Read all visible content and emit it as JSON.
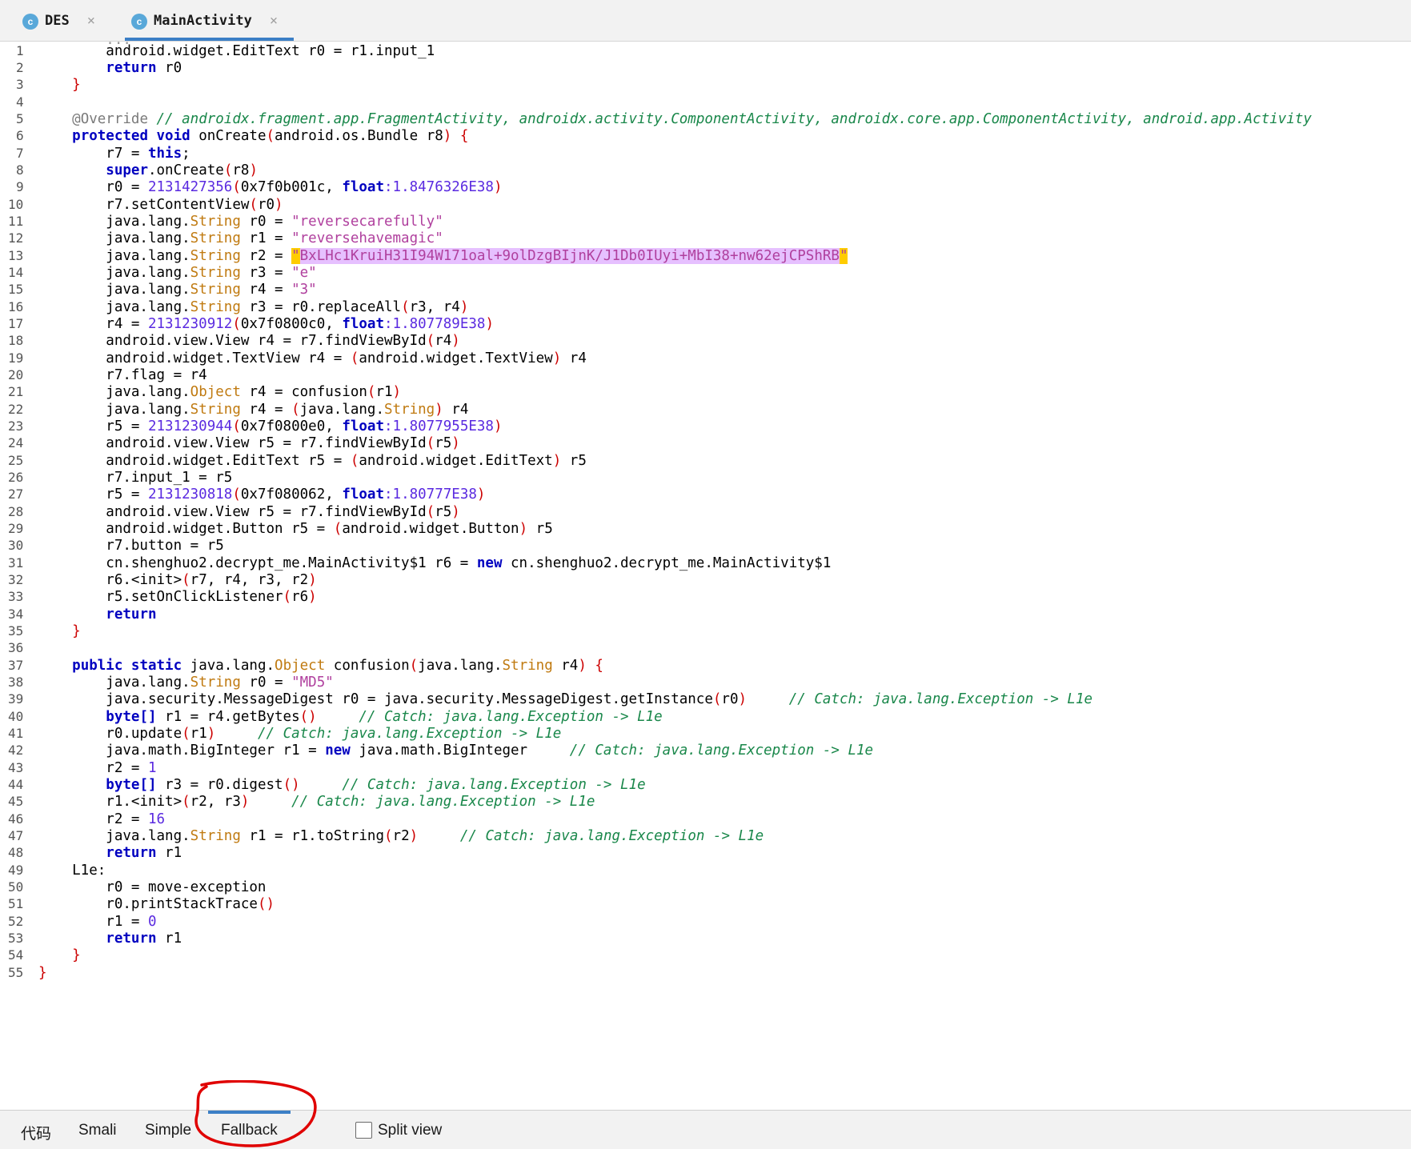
{
  "tabs": [
    {
      "icon": "class-icon",
      "icon_letter": "c",
      "label": "DES"
    },
    {
      "icon": "class-icon",
      "icon_letter": "c",
      "label": "MainActivity"
    }
  ],
  "close_glyph": "×",
  "line_numbers": [
    "1",
    "2",
    "3",
    "4",
    "5",
    "6",
    "7",
    "8",
    "9",
    "10",
    "11",
    "12",
    "13",
    "14",
    "15",
    "16",
    "17",
    "18",
    "19",
    "20",
    "21",
    "22",
    "23",
    "24",
    "25",
    "26",
    "27",
    "28",
    "29",
    "30",
    "31",
    "32",
    "33",
    "34",
    "35",
    "36",
    "37",
    "38",
    "39",
    "40",
    "41",
    "42",
    "43",
    "44",
    "45",
    "46",
    "47",
    "48",
    "49",
    "50",
    "51",
    "52",
    "53",
    "54",
    "55"
  ],
  "code": {
    "l1_a": "        android.widget.EditText r0 = r1.input_1",
    "l2_kw": "return",
    "l2_b": " r0",
    "l3_brace": "}",
    "l5_ann": "@Override",
    "l5_cm": " // androidx.fragment.app.FragmentActivity, androidx.activity.ComponentActivity, androidx.core.app.ComponentActivity, android.app.Activity",
    "l6_kw": "protected void",
    "l6_b": " onCreate",
    "l6_p": "(",
    "l6_c": "android.os.Bundle r8",
    "l6_e": ") {",
    "l7_a": "        r7 = ",
    "l7_kw": "this",
    "l7_b": ";",
    "l8_kw": "super",
    "l8_a": ".onCreate",
    "l8_p1": "(",
    "l8_b": "r8",
    "l8_p2": ")",
    "l9_a": "        r0 = ",
    "l9_n": "2131427356",
    "l9_p1": "(",
    "l9_h": "0x7f0b001c",
    "l9_c": ", ",
    "l9_kw": "float",
    "l9_n2": ":1.8476326E38",
    "l9_p2": ")",
    "l10_a": "        r7.setContentView",
    "l10_p1": "(",
    "l10_b": "r0",
    "l10_p2": ")",
    "l11_a": "        java.lang.",
    "l11_t": "String",
    "l11_b": " r0 = ",
    "l11_s": "\"reversecarefully\"",
    "l12_a": "        java.lang.",
    "l12_t": "String",
    "l12_b": " r1 = ",
    "l12_s": "\"reversehavemagic\"",
    "l13_a": "        java.lang.",
    "l13_t": "String",
    "l13_b": " r2 = ",
    "l13_q1": "\"",
    "l13_s": "BxLHc1KruiH31I94W171oal+9olDzgBIjnK/J1Db0IUyi+MbI38+nw62ejCPShRB",
    "l13_q2": "\"",
    "l14_a": "        java.lang.",
    "l14_t": "String",
    "l14_b": " r3 = ",
    "l14_s": "\"e\"",
    "l15_a": "        java.lang.",
    "l15_t": "String",
    "l15_b": " r4 = ",
    "l15_s": "\"3\"",
    "l16_a": "        java.lang.",
    "l16_t": "String",
    "l16_b": " r3 = r0.replaceAll",
    "l16_p1": "(",
    "l16_c": "r3, r4",
    "l16_p2": ")",
    "l17_a": "        r4 = ",
    "l17_n": "2131230912",
    "l17_p1": "(",
    "l17_h": "0x7f0800c0",
    "l17_c": ", ",
    "l17_kw": "float",
    "l17_n2": ":1.807789E38",
    "l17_p2": ")",
    "l18_a": "        android.view.View r4 = r7.findViewById",
    "l18_p1": "(",
    "l18_b": "r4",
    "l18_p2": ")",
    "l19_a": "        android.widget.TextView r4 = ",
    "l19_p1": "(",
    "l19_b": "android.widget.TextView",
    "l19_p2": ")",
    "l19_c": " r4",
    "l20_a": "        r7.flag = r4",
    "l21_a": "        java.lang.",
    "l21_t": "Object",
    "l21_b": " r4 = confusion",
    "l21_p1": "(",
    "l21_c": "r1",
    "l21_p2": ")",
    "l22_a": "        java.lang.",
    "l22_t": "String",
    "l22_b": " r4 = ",
    "l22_p1": "(",
    "l22_c": "java.lang.",
    "l22_t2": "String",
    "l22_p2": ")",
    "l22_d": " r4",
    "l23_a": "        r5 = ",
    "l23_n": "2131230944",
    "l23_p1": "(",
    "l23_h": "0x7f0800e0",
    "l23_c": ", ",
    "l23_kw": "float",
    "l23_n2": ":1.8077955E38",
    "l23_p2": ")",
    "l24_a": "        android.view.View r5 = r7.findViewById",
    "l24_p1": "(",
    "l24_b": "r5",
    "l24_p2": ")",
    "l25_a": "        android.widget.EditText r5 = ",
    "l25_p1": "(",
    "l25_b": "android.widget.EditText",
    "l25_p2": ")",
    "l25_c": " r5",
    "l26_a": "        r7.input_1 = r5",
    "l27_a": "        r5 = ",
    "l27_n": "2131230818",
    "l27_p1": "(",
    "l27_h": "0x7f080062",
    "l27_c": ", ",
    "l27_kw": "float",
    "l27_n2": ":1.80777E38",
    "l27_p2": ")",
    "l28_a": "        android.view.View r5 = r7.findViewById",
    "l28_p1": "(",
    "l28_b": "r5",
    "l28_p2": ")",
    "l29_a": "        android.widget.Button r5 = ",
    "l29_p1": "(",
    "l29_b": "android.widget.Button",
    "l29_p2": ")",
    "l29_c": " r5",
    "l30_a": "        r7.button = r5",
    "l31_a": "        cn.shenghuo2.decrypt_me.MainActivity$1 r6 = ",
    "l31_kw": "new",
    "l31_b": " cn.shenghuo2.decrypt_me.MainActivity$1",
    "l32_a": "        r6.",
    "l32_p0": "<init>",
    "l32_p1": "(",
    "l32_b": "r7, r4, r3, r2",
    "l32_p2": ")",
    "l33_a": "        r5.setOnClickListener",
    "l33_p1": "(",
    "l33_b": "r6",
    "l33_p2": ")",
    "l34_kw": "return",
    "l35_brace": "}",
    "l37_kw": "public static",
    "l37_a": " java.lang.",
    "l37_t": "Object",
    "l37_b": " confusion",
    "l37_p1": "(",
    "l37_c": "java.lang.",
    "l37_t2": "String",
    "l37_d": " r4",
    "l37_p2": ") {",
    "l38_a": "        java.lang.",
    "l38_t": "String",
    "l38_b": " r0 = ",
    "l38_s": "\"MD5\"",
    "l39_a": "        java.security.MessageDigest r0 = java.security.MessageDigest.getInstance",
    "l39_p1": "(",
    "l39_b": "r0",
    "l39_p2": ")",
    "l39_cm": "     // Catch: java.lang.Exception -> L1e",
    "l40_kw": "byte[]",
    "l40_a": " r1 = r4.getBytes",
    "l40_p": "()",
    "l40_cm": "     // Catch: java.lang.Exception -> L1e",
    "l41_a": "        r0.update",
    "l41_p1": "(",
    "l41_b": "r1",
    "l41_p2": ")",
    "l41_cm": "     // Catch: java.lang.Exception -> L1e",
    "l42_a": "        java.math.BigInteger r1 = ",
    "l42_kw": "new",
    "l42_b": " java.math.BigInteger",
    "l42_cm": "     // Catch: java.lang.Exception -> L1e",
    "l43_a": "        r2 = ",
    "l43_n": "1",
    "l44_kw": "byte[]",
    "l44_a": " r3 = r0.digest",
    "l44_p": "()",
    "l44_cm": "     // Catch: java.lang.Exception -> L1e",
    "l45_a": "        r1.",
    "l45_p0": "<init>",
    "l45_p1": "(",
    "l45_b": "r2, r3",
    "l45_p2": ")",
    "l45_cm": "     // Catch: java.lang.Exception -> L1e",
    "l46_a": "        r2 = ",
    "l46_n": "16",
    "l47_a": "        java.lang.",
    "l47_t": "String",
    "l47_b": " r1 = r1.toString",
    "l47_p1": "(",
    "l47_c": "r2",
    "l47_p2": ")",
    "l47_cm": "     // Catch: java.lang.Exception -> L1e",
    "l48_kw": "return",
    "l48_b": " r1",
    "l49_a": "    L1e:",
    "l50_a": "        r0 = move-exception",
    "l51_a": "        r0.printStackTrace",
    "l51_p": "()",
    "l52_a": "        r1 = ",
    "l52_n": "0",
    "l53_kw": "return",
    "l53_b": " r1",
    "l54_brace": "}",
    "l55_brace": "}"
  },
  "bottom_tabs": [
    "代码",
    "Smali",
    "Simple",
    "Fallback"
  ],
  "active_bottom_tab": "Fallback",
  "split_view": {
    "label": "Split view",
    "checked": false
  },
  "colors": {
    "accent": "#3c7fc6",
    "keyword": "#0000c0",
    "string": "#b0409e",
    "comment": "#19874a",
    "number": "#5a2ae0",
    "type": "#c07a10",
    "punct": "#cc0000",
    "highlight": "#e6c0ff",
    "annotation_circle": "#e00000"
  }
}
